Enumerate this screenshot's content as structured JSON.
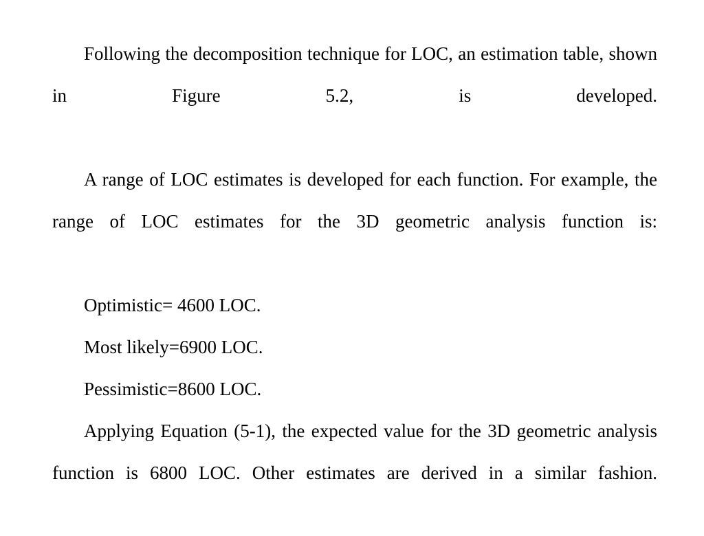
{
  "page": {
    "background_color": "#ffffff",
    "text_color": "#000000",
    "alignment": "justified"
  },
  "body": {
    "paragraphs": [
      {
        "id": "intro-decomposition",
        "text": "Following the decomposition technique for LOC, an estimation table, shown in Figure 5.2, is developed."
      },
      {
        "id": "range-of-loc-estimates",
        "text": "A range of LOC estimates is developed for each function. For example, the range of LOC estimates for the 3D geometric analysis function is:"
      }
    ],
    "estimates": [
      {
        "id": "optimistic",
        "label": "Optimistic",
        "value": "4600",
        "unit": "LOC",
        "text": "Optimistic= 4600 LOC."
      },
      {
        "id": "most-likely",
        "label": "Most likely",
        "value": "6900",
        "unit": "LOC",
        "text": "Most likely=6900 LOC."
      },
      {
        "id": "pessimistic",
        "label": "Pessimistic",
        "value": "8600",
        "unit": "LOC",
        "text": "Pessimistic=8600 LOC."
      }
    ],
    "closing_paragraphs": [
      {
        "id": "expected-value",
        "text": "Applying Equation (5-1), the expected value for the 3D geometric analysis function is 6800 LOC. Other estimates are derived in a similar fashion."
      }
    ]
  }
}
